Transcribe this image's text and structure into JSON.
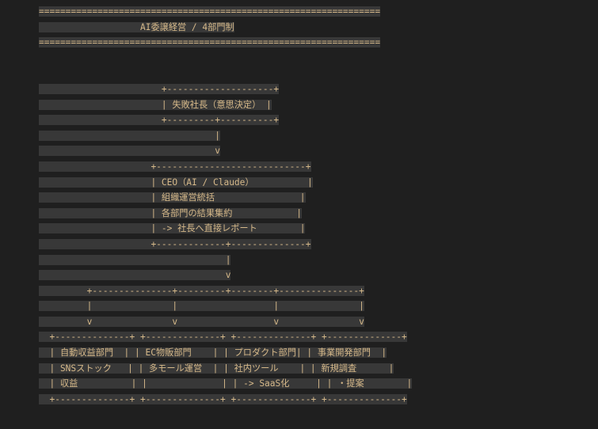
{
  "document": {
    "title": "AI委譲経営 / 4部門制",
    "lines": [
      "================================================================",
      "                   AI委譲経営 / 4部門制",
      "================================================================",
      "",
      "",
      "                       +--------------------+",
      "                       | 失敗社長（意思決定） |",
      "                       +---------+----------+",
      "                                 |",
      "                                 v",
      "                     +----------------------------+",
      "                     | CEO（AI / Claude）          |",
      "                     | 組織運営統括                |",
      "                     | 各部門の結果集約            |",
      "                     | -> 社長へ直接レポート        |",
      "                     +-------------+--------------+",
      "                                   |",
      "                                   v",
      "         +---------------+---------+--------+---------------+",
      "         |               |                  |               |",
      "         v               v                  v               v",
      "  +--------------+ +--------------+ +--------------+ +--------------+",
      "  | 自動収益部門  | | EC物販部門    | | プロダクト部門| | 事業開発部門  |",
      "  | SNSストック   | | 多モール運営  | | 社内ツール    | | 新規調査      |",
      "  | 収益          | |              | | -> SaaS化     | | ・提案        |",
      "  +--------------+ +--------------+ +--------------+ +--------------+"
    ]
  }
}
